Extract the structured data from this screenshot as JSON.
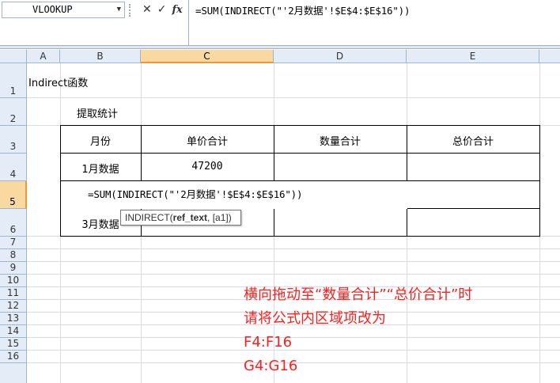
{
  "formula_bar": {
    "name_box": "VLOOKUP",
    "cancel_icon": "✕",
    "enter_icon": "✓",
    "fx_label": "fx",
    "formula": "=SUM(INDIRECT(\"'2月数据'!$E$4:$E$16\"))"
  },
  "columns": [
    "A",
    "B",
    "C",
    "D",
    "E"
  ],
  "selected_column": "C",
  "rows": [
    "1",
    "2",
    "3",
    "4",
    "5",
    "6",
    "7",
    "8",
    "9",
    "10",
    "11",
    "12",
    "13",
    "14",
    "15",
    "16"
  ],
  "selected_row": "5",
  "cells": {
    "title": "Indirect函数",
    "subtitle": "提取统计",
    "header_month": "月份",
    "header_unit_price": "单价合计",
    "header_quantity": "数量合计",
    "header_total_price": "总价合计",
    "row4_month": "1月数据",
    "row4_value": "47200",
    "row5_editing": "=SUM(INDIRECT(\"'2月数据'!$E$4:$E$16\"))",
    "row6_month": "3月数据"
  },
  "tooltip": {
    "func": "INDIRECT(",
    "arg_bold": "ref_text",
    "rest": ", [a1])"
  },
  "note": {
    "line1": "横向拖动至“数量合计”“总价合计”时",
    "line2": "请将公式内区域项改为",
    "line3": "F4:F16",
    "line4": "G4:G16",
    "color": "#ff1e1e"
  }
}
